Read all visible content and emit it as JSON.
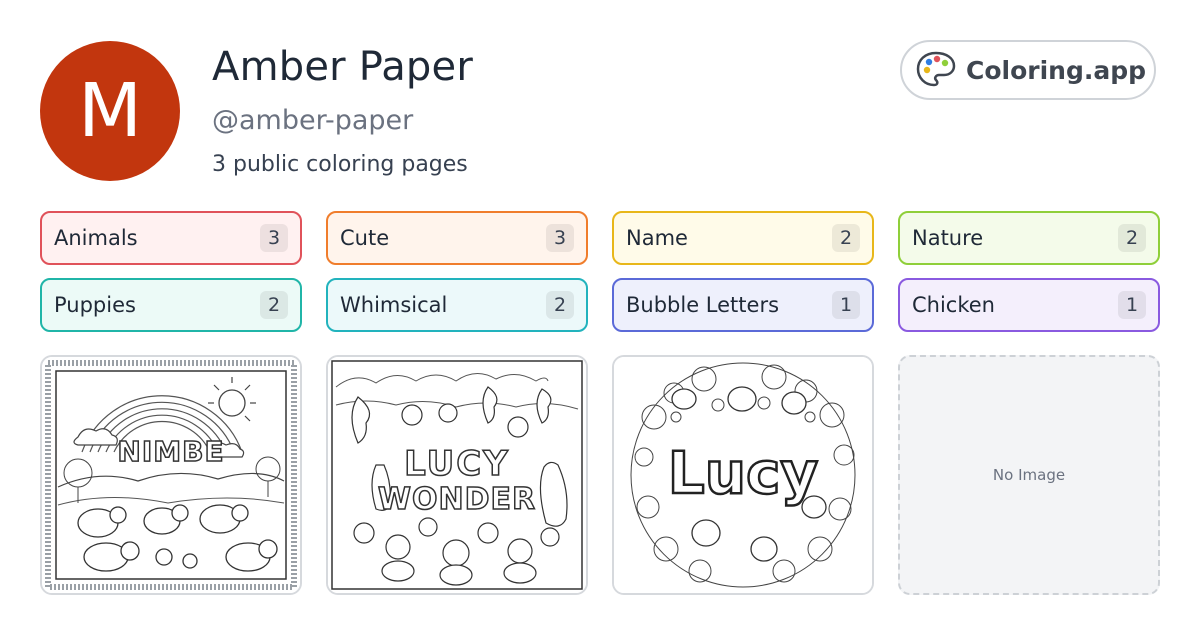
{
  "profile": {
    "initial": "M",
    "name": "Amber Paper",
    "handle": "@amber-paper",
    "count_text": "3 public coloring pages",
    "avatar_color": "#c2360e"
  },
  "brand": {
    "label": "Coloring.app",
    "icon": "palette-icon"
  },
  "tags": [
    {
      "label": "Animals",
      "count": "3",
      "border": "#e0525a",
      "bg": "#fff1f1"
    },
    {
      "label": "Cute",
      "count": "3",
      "border": "#f07d2c",
      "bg": "#fff4ec"
    },
    {
      "label": "Name",
      "count": "2",
      "border": "#e8b71a",
      "bg": "#fffbe9"
    },
    {
      "label": "Nature",
      "count": "2",
      "border": "#8fcf3a",
      "bg": "#f4fbea"
    },
    {
      "label": "Puppies",
      "count": "2",
      "border": "#20b5a8",
      "bg": "#ecfaf7"
    },
    {
      "label": "Whimsical",
      "count": "2",
      "border": "#22b3bd",
      "bg": "#ecf9fa"
    },
    {
      "label": "Bubble Letters",
      "count": "1",
      "border": "#5b6ad8",
      "bg": "#eef0fc"
    },
    {
      "label": "Chicken",
      "count": "1",
      "border": "#8a5ae0",
      "bg": "#f4effc"
    }
  ],
  "cards": [
    {
      "title_text": "NIMBE",
      "kind": "image"
    },
    {
      "title_text": "LUCY WONDER",
      "line1": "LUCY",
      "line2": "WONDER",
      "kind": "image"
    },
    {
      "title_text": "Lucy",
      "kind": "image"
    },
    {
      "kind": "empty",
      "empty_text": "No Image"
    }
  ]
}
